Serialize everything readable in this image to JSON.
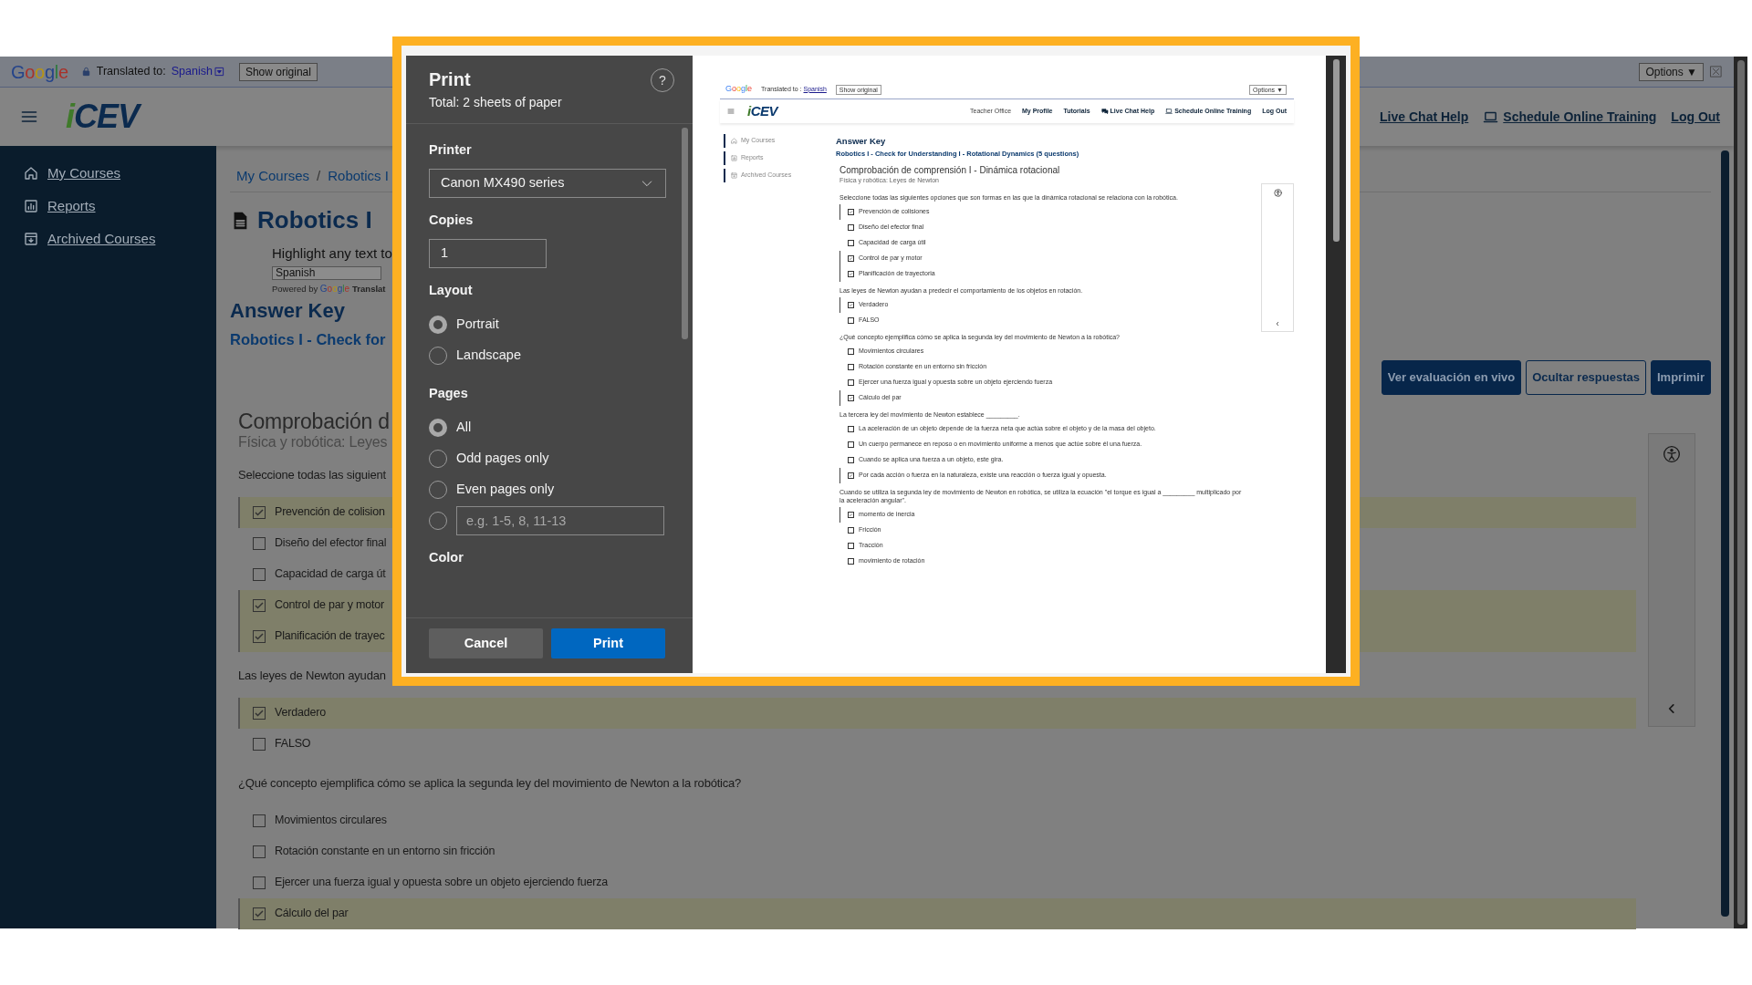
{
  "browser_page": {
    "translate_bar": {
      "logo": "Google",
      "label": "Translated to:",
      "language": "Spanish",
      "show_original": "Show original",
      "options": "Options ▼"
    },
    "navbar": {
      "logo": "iCEV",
      "links": [
        "Live Chat Help",
        "Schedule Online Training",
        "Log Out"
      ]
    },
    "sidebar": [
      "My Courses",
      "Reports",
      "Archived Courses"
    ],
    "breadcrumb": {
      "items": [
        "My Courses",
        "Robotics I"
      ],
      "separator": "/"
    },
    "title": "Robotics I",
    "translate_widget": {
      "hint": "Highlight any text to",
      "language": "Spanish",
      "powered_by": "Powered by",
      "brand": "Google",
      "product": "Translat"
    },
    "heading": "Answer Key",
    "subheading": "Robotics I - Check for",
    "buttons": [
      {
        "label": "Ver evaluación en vivo",
        "kind": "solid"
      },
      {
        "label": "Ocultar respuestas",
        "kind": "outline"
      },
      {
        "label": "Imprimir",
        "kind": "solid"
      }
    ],
    "quiz": {
      "title": "Comprobación d",
      "subtitle": "Física y robótica: Leyes",
      "questions": [
        {
          "prompt": "Seleccione todas las siguient",
          "options": [
            {
              "text": "Prevención de colision",
              "checked": true
            },
            {
              "text": "Diseño del efector final",
              "checked": false
            },
            {
              "text": "Capacidad de carga út",
              "checked": false
            },
            {
              "text": "Control de par y motor",
              "checked": true
            },
            {
              "text": "Planificación de trayec",
              "checked": true
            }
          ]
        },
        {
          "prompt": "Las leyes de Newton ayudan",
          "options": [
            {
              "text": "Verdadero",
              "checked": true
            },
            {
              "text": "FALSO",
              "checked": false
            }
          ]
        },
        {
          "prompt": "¿Qué concepto ejemplifica cómo se aplica la segunda ley del movimiento de Newton a la robótica?",
          "options": [
            {
              "text": "Movimientos circulares",
              "checked": false
            },
            {
              "text": "Rotación constante en un entorno sin fricción",
              "checked": false
            },
            {
              "text": "Ejercer una fuerza igual y opuesta sobre un objeto ejerciendo fuerza",
              "checked": false
            },
            {
              "text": "Cálculo del par",
              "checked": true
            }
          ]
        }
      ]
    }
  },
  "print_dialog": {
    "title": "Print",
    "summary": "Total: 2 sheets of paper",
    "help": "?",
    "printer": {
      "label": "Printer",
      "value": "Canon MX490 series"
    },
    "copies": {
      "label": "Copies",
      "value": "1"
    },
    "layout": {
      "label": "Layout",
      "options": [
        {
          "label": "Portrait",
          "selected": true
        },
        {
          "label": "Landscape",
          "selected": false
        }
      ]
    },
    "pages": {
      "label": "Pages",
      "options": [
        {
          "label": "All",
          "selected": true
        },
        {
          "label": "Odd pages only",
          "selected": false
        },
        {
          "label": "Even pages only",
          "selected": false
        }
      ],
      "custom": {
        "selected": false,
        "placeholder": "e.g. 1-5, 8, 11-13"
      }
    },
    "color": {
      "label": "Color"
    },
    "buttons": [
      {
        "label": "Cancel",
        "kind": "secondary"
      },
      {
        "label": "Print",
        "kind": "primary"
      }
    ],
    "preview": {
      "translate_bar": {
        "logo": "Google",
        "label": "Translated to :",
        "language": "Spanish",
        "show_original": "Show original",
        "options": "Options ▼"
      },
      "navbar": {
        "logo": "iCEV",
        "links": [
          "Teacher Office",
          "My Profile",
          "Tutorials",
          "Live Chat Help",
          "Schedule Online Training",
          "Log Out"
        ]
      },
      "sidebar": [
        "My Courses",
        "Reports",
        "Archived Courses"
      ],
      "heading": "Answer Key",
      "subheading": "Robotics I - Check for Understanding I - Rotational Dynamics (5 questions)",
      "quiz": {
        "title": "Comprobación de comprensión I - Dinámica rotacional",
        "subtitle": "Física y robótica: Leyes de Newton",
        "questions": [
          {
            "prompt": "Seleccione todas las siguientes opciones que son formas en las que la dinámica rotacional se relaciona con la robótica.",
            "options": [
              {
                "text": "Prevención de colisiones",
                "checked": true
              },
              {
                "text": "Diseño del efector final",
                "checked": false
              },
              {
                "text": "Capacidad de carga útil",
                "checked": false
              },
              {
                "text": "Control de par y motor",
                "checked": true
              },
              {
                "text": "Planificación de trayectoria",
                "checked": true
              }
            ]
          },
          {
            "prompt": "Las leyes de Newton ayudan a predecir el comportamiento de los objetos en rotación.",
            "options": [
              {
                "text": "Verdadero",
                "checked": true
              },
              {
                "text": "FALSO",
                "checked": false
              }
            ]
          },
          {
            "prompt": "¿Qué concepto ejemplifica cómo se aplica la segunda ley del movimiento de Newton a la robótica?",
            "options": [
              {
                "text": "Movimientos circulares",
                "checked": false
              },
              {
                "text": "Rotación constante en un entorno sin fricción",
                "checked": false
              },
              {
                "text": "Ejercer una fuerza igual y opuesta sobre un objeto ejerciendo fuerza",
                "checked": false
              },
              {
                "text": "Cálculo del par",
                "checked": true
              }
            ]
          },
          {
            "prompt": "La tercera ley del movimiento de Newton establece _________.",
            "options": [
              {
                "text": "La aceleración de un objeto depende de la fuerza neta que actúa sobre el objeto y de la masa del objeto.",
                "checked": false
              },
              {
                "text": "Un cuerpo permanece en reposo o en movimiento uniforme a menos que actúe sobre él una fuerza.",
                "checked": false
              },
              {
                "text": "Cuando se aplica una fuerza a un objeto, este gira.",
                "checked": false
              },
              {
                "text": "Por cada acción o fuerza en la naturaleza, existe una reacción o fuerza igual y opuesta.",
                "checked": true
              }
            ]
          },
          {
            "prompt": "Cuando se utiliza la segunda ley de movimiento de Newton en robótica, se utiliza la ecuación \"el torque es igual a _________ multiplicado por la aceleración angular\".",
            "options": [
              {
                "text": "momento de inercia",
                "checked": true
              },
              {
                "text": "Fricción",
                "checked": false
              },
              {
                "text": "Tracción",
                "checked": false
              },
              {
                "text": "movimiento de rotación",
                "checked": false
              }
            ]
          }
        ]
      }
    }
  }
}
